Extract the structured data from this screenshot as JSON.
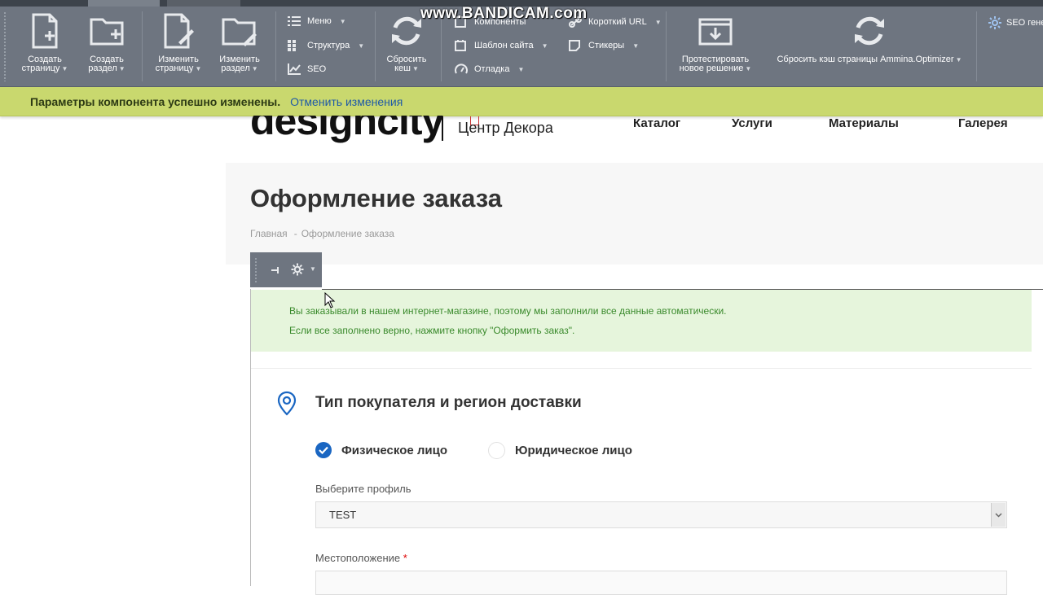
{
  "watermark": "www.BANDICAM.com",
  "toolbar": {
    "create_page": {
      "line1": "Создать",
      "line2": "страницу"
    },
    "create_section": {
      "line1": "Создать",
      "line2": "раздел"
    },
    "edit_page": {
      "line1": "Изменить",
      "line2": "страницу"
    },
    "edit_section": {
      "line1": "Изменить",
      "line2": "раздел"
    },
    "menu": "Меню",
    "structure": "Структура",
    "seo": "SEO",
    "reset_cache": {
      "line1": "Сбросить",
      "line2": "кеш"
    },
    "components": "Компоненты",
    "site_template": "Шаблон сайта",
    "debug": "Отладка",
    "short_url": "Короткий URL",
    "stickers": "Стикеры",
    "test_solution": {
      "line1": "Протестировать",
      "line2": "новое решение"
    },
    "reset_page_cache": "Сбросить кэш страницы Ammina.Optimizer",
    "seo_gen": "SEO гене"
  },
  "notification": {
    "message": "Параметры компонента успешно изменены.",
    "undo": "Отменить изменения"
  },
  "header": {
    "logo": "designcity",
    "logo_sub": "Центр Декора",
    "nav": [
      "Каталог",
      "Услуги",
      "Материалы",
      "Галерея"
    ]
  },
  "page": {
    "title": "Оформление заказа",
    "breadcrumbs": [
      "Главная",
      "Оформление заказа"
    ]
  },
  "order": {
    "alert_line1": "Вы заказывали в нашем интернет-магазине, поэтому мы заполнили все данные автоматически.",
    "alert_line2": "Если все заполнено верно, нажмите кнопку \"Оформить заказ\".",
    "section_title": "Тип покупателя и регион доставки",
    "person_types": [
      {
        "label": "Физическое лицо",
        "checked": true
      },
      {
        "label": "Юридическое лицо",
        "checked": false
      }
    ],
    "profile_label": "Выберите профиль",
    "profile_value": "TEST",
    "location_label": "Местоположение",
    "required_mark": "*"
  },
  "colors": {
    "toolbar_bg": "#6e7580",
    "notify_bg": "#c9d86e",
    "accent_blue": "#1a66c2",
    "alert_green_bg": "#e6f5dc",
    "alert_green_text": "#3a8a2c"
  }
}
